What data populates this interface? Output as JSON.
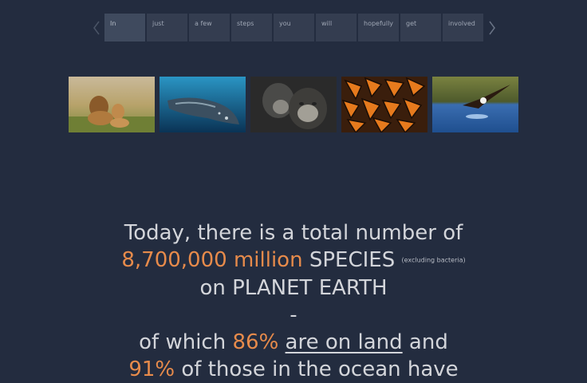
{
  "nav": {
    "steps": [
      {
        "label": "In"
      },
      {
        "label": "just"
      },
      {
        "label": "a few"
      },
      {
        "label": "steps"
      },
      {
        "label": "you"
      },
      {
        "label": "will"
      },
      {
        "label": "hopefully"
      },
      {
        "label": "get"
      },
      {
        "label": "involved"
      }
    ],
    "prev_icon": "chevron-left-icon",
    "next_icon": "chevron-right-icon"
  },
  "gallery": {
    "images": [
      {
        "name": "lions"
      },
      {
        "name": "whale"
      },
      {
        "name": "chimpanzees"
      },
      {
        "name": "monarch-butterflies"
      },
      {
        "name": "eagle"
      }
    ]
  },
  "statement": {
    "line1": "Today, there is a total number of",
    "count": "8,700,000 million",
    "species": "SPECIES",
    "excluding": "(excluding bacteria)",
    "line3": "on PLANET EARTH",
    "dash": "-",
    "of_which": "of which",
    "land_pct": "86%",
    "on_land": "are on land",
    "and": "and",
    "sea_pct": "91%",
    "line5_rest": "of those in the ocean have"
  },
  "colors": {
    "background": "#232c3f",
    "accent": "#e78b4b",
    "step": "#343d50"
  }
}
